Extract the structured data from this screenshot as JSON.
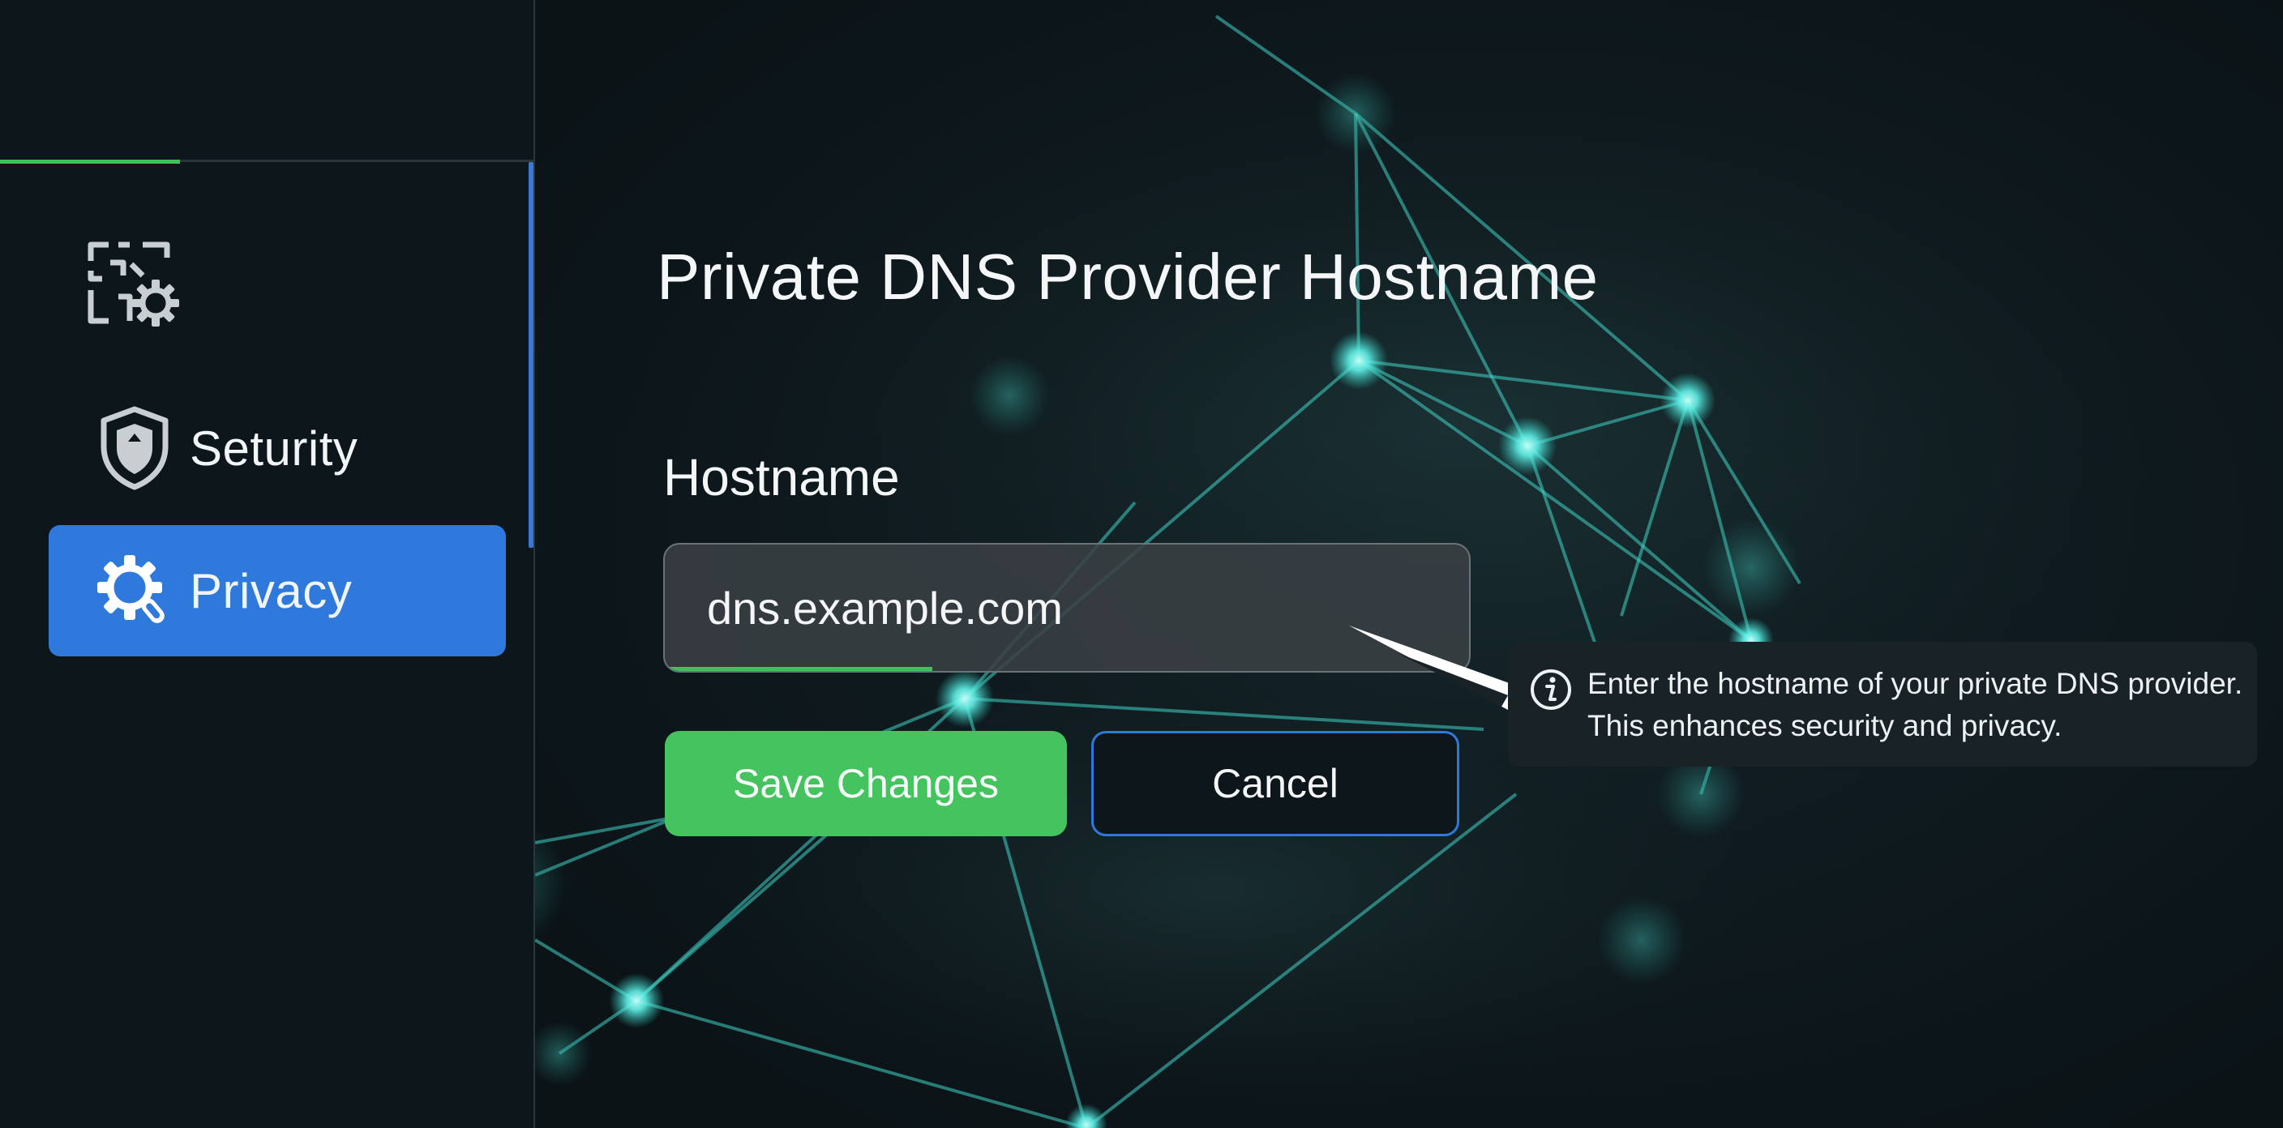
{
  "theme": {
    "accent_blue": "#2f78dc",
    "accent_green": "#44c35f",
    "background": "#0c1418",
    "network_node": "#5ff0e6"
  },
  "sidebar": {
    "logo_icon": "qr-settings-icon",
    "items": [
      {
        "label": "Seturity",
        "icon": "shield-icon",
        "active": false
      },
      {
        "label": "Privacy",
        "icon": "gear-privacy-icon",
        "active": true
      }
    ]
  },
  "main": {
    "title": "Private DNS Provider Hostname",
    "field": {
      "label": "Hostname",
      "value": "dns.example.com",
      "placeholder": ""
    },
    "buttons": {
      "save_label": "Save Changes",
      "cancel_label": "Cancel"
    },
    "tooltip": {
      "icon": "info-icon",
      "line1": "Enter the hostname of your private DNS provider.",
      "line2": "This enhances security and privacy."
    }
  }
}
